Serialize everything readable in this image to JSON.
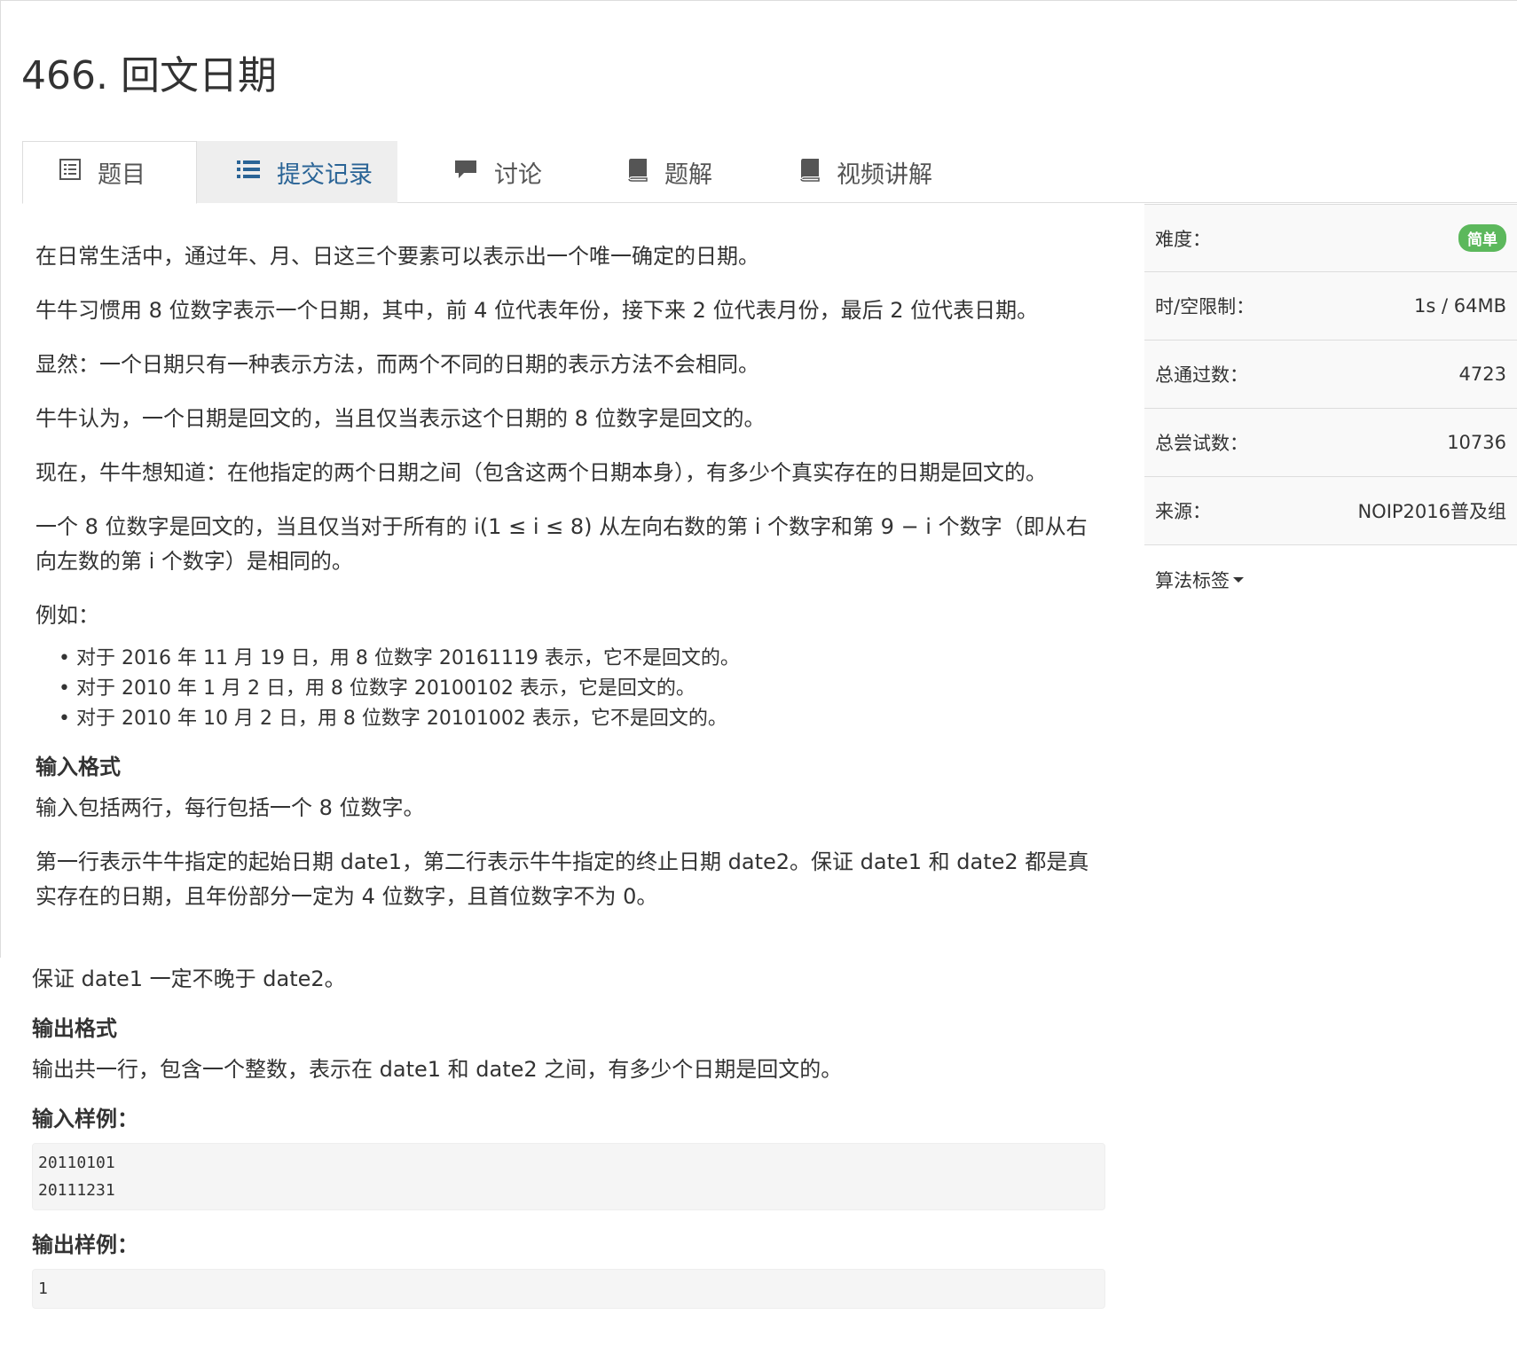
{
  "problem": {
    "title": "466. 回文日期"
  },
  "tabs": [
    {
      "label": "题目"
    },
    {
      "label": "提交记录"
    },
    {
      "label": "讨论"
    },
    {
      "label": "题解"
    },
    {
      "label": "视频讲解"
    }
  ],
  "statement": {
    "p1": "在日常生活中，通过年、月、日这三个要素可以表示出一个唯一确定的日期。",
    "p2": "牛牛习惯用 8 位数字表示一个日期，其中，前 4 位代表年份，接下来 2 位代表月份，最后 2 位代表日期。",
    "p3": "显然：一个日期只有一种表示方法，而两个不同的日期的表示方法不会相同。",
    "p4": "牛牛认为，一个日期是回文的，当且仅当表示这个日期的 8 位数字是回文的。",
    "p5": "现在，牛牛想知道：在他指定的两个日期之间（包含这两个日期本身），有多少个真实存在的日期是回文的。",
    "p6": "一个 8 位数字是回文的，当且仅当对于所有的 i(1 ≤ i ≤ 8) 从左向右数的第 i 个数字和第 9 − i 个数字（即从右向左数的第 i 个数字）是相同的。",
    "p7": "例如：",
    "examples": [
      "对于 2016 年 11 月 19 日，用 8 位数字 20161119 表示，它不是回文的。",
      "对于 2010 年 1 月 2 日，用 8 位数字 20100102 表示，它是回文的。",
      "对于 2010 年 10 月 2 日，用 8 位数字 20101002 表示，它不是回文的。"
    ],
    "input_heading": "输入格式",
    "input_p1": "输入包括两行，每行包括一个 8 位数字。",
    "input_p2": "第一行表示牛牛指定的起始日期 date1，第二行表示牛牛指定的终止日期 date2。保证 date1 和 date2 都是真实存在的日期，且年份部分一定为 4 位数字，且首位数字不为 0。",
    "input_p3": "保证 date1 一定不晚于 date2。",
    "output_heading": "输出格式",
    "output_p1": "输出共一行，包含一个整数，表示在 date1 和 date2 之间，有多少个日期是回文的。",
    "sample_in_heading": "输入样例：",
    "sample_in": "20110101\n20111231",
    "sample_out_heading": "输出样例：",
    "sample_out": "1"
  },
  "sidebar": {
    "difficulty_label": "难度：",
    "difficulty_value": "简单",
    "limit_label": "时/空限制：",
    "limit_value": "1s / 64MB",
    "passed_label": "总通过数：",
    "passed_value": "4723",
    "tried_label": "总尝试数：",
    "tried_value": "10736",
    "source_label": "来源：",
    "source_value": "NOIP2016普及组",
    "tags_label": "算法标签"
  },
  "colors": {
    "difficulty_easy": "#5cb85c",
    "active_tab_text": "#2a6496"
  }
}
